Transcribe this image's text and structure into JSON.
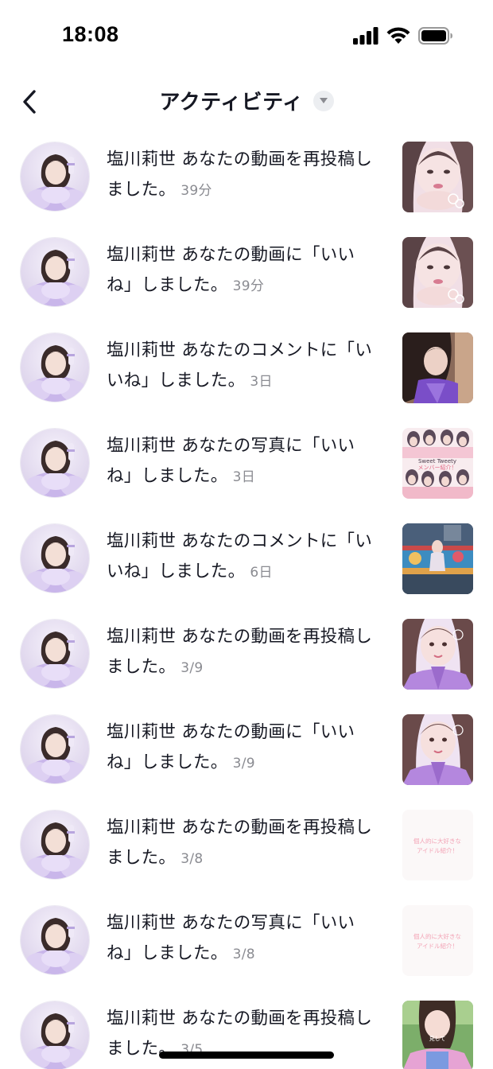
{
  "status": {
    "time": "18:08"
  },
  "header": {
    "title": "アクティビティ"
  },
  "notifications": [
    {
      "user": "塩川莉世",
      "text": "あなたの動画を再投稿しました。",
      "time": "39分",
      "thumb": "t1"
    },
    {
      "user": "塩川莉世",
      "text": "あなたの動画に「いいね」しました。",
      "time": "39分",
      "thumb": "t1"
    },
    {
      "user": "塩川莉世",
      "text": "あなたのコメントに「いいね」しました。",
      "time": "3日",
      "thumb": "t2"
    },
    {
      "user": "塩川莉世",
      "text": "あなたの写真に「いいね」しました。",
      "time": "3日",
      "thumb": "t3",
      "thumb_text": "Sweet Tweety ティーブとなメンバー紹介！"
    },
    {
      "user": "塩川莉世",
      "text": "あなたのコメントに「いいね」しました。",
      "time": "6日",
      "thumb": "t4"
    },
    {
      "user": "塩川莉世",
      "text": "あなたの動画を再投稿しました。",
      "time": "3/9",
      "thumb": "t5"
    },
    {
      "user": "塩川莉世",
      "text": "あなたの動画に「いいね」しました。",
      "time": "3/9",
      "thumb": "t5"
    },
    {
      "user": "塩川莉世",
      "text": "あなたの動画を再投稿しました。",
      "time": "3/8",
      "thumb": "t6",
      "thumb_text": "個人的に大好きなアイドル紹介！"
    },
    {
      "user": "塩川莉世",
      "text": "あなたの写真に「いいね」しました。",
      "time": "3/8",
      "thumb": "t6",
      "thumb_text": "個人的に大好きなアイドル紹介！"
    },
    {
      "user": "塩川莉世",
      "text": "あなたの動画を再投稿しました。",
      "time": "3/5",
      "thumb": "t7",
      "thumb_text": "見して"
    }
  ]
}
